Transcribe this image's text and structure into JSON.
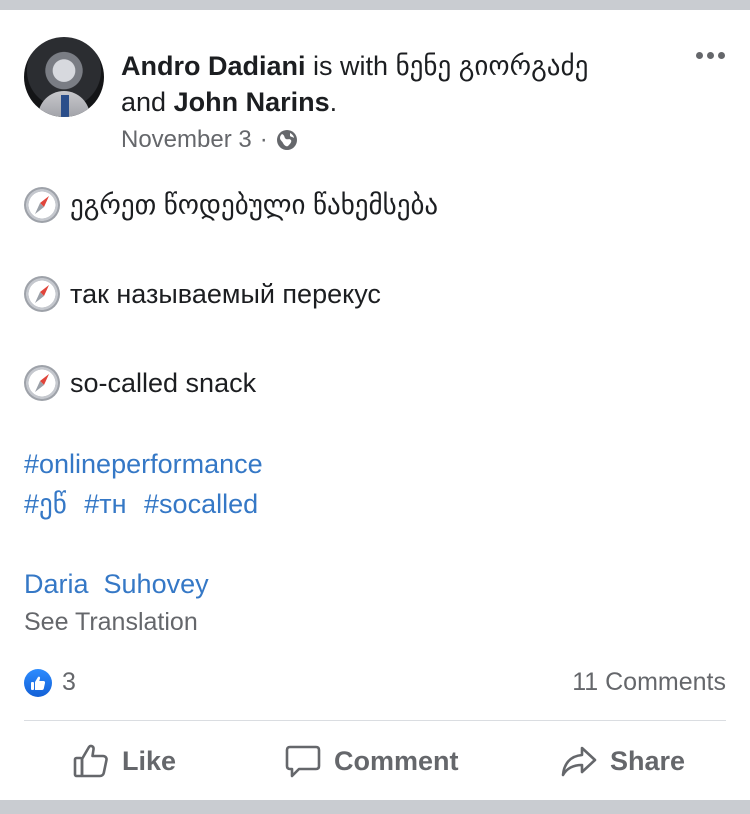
{
  "post": {
    "author": "Andro Dadiani",
    "with_text": "is with",
    "tagged_1": "ნენე გიორგაძე",
    "and_text": "and",
    "tagged_2": "John Narins",
    "period": ".",
    "date": "November 3",
    "separator": "·",
    "audience_icon": "globe-icon",
    "lines": [
      {
        "icon": "compass-icon",
        "text": "ეგრეთ წოდებული წახემსება"
      },
      {
        "icon": "compass-icon",
        "text": "так называемый перекус"
      },
      {
        "icon": "compass-icon",
        "text": "so-called snack"
      }
    ],
    "hashtag_line_1": "#onlineperformance",
    "hashtags_line_2": [
      "#ეწ",
      "#тн",
      "#socalled"
    ],
    "mention": "Daria  Suhovey",
    "see_translation": "See Translation"
  },
  "stats": {
    "like_count": "3",
    "comments": "11 Comments"
  },
  "actions": {
    "like": "Like",
    "comment": "Comment",
    "share": "Share"
  },
  "colors": {
    "link": "#3578c6",
    "muted": "#65676b",
    "like_blue": "#1877f2"
  }
}
